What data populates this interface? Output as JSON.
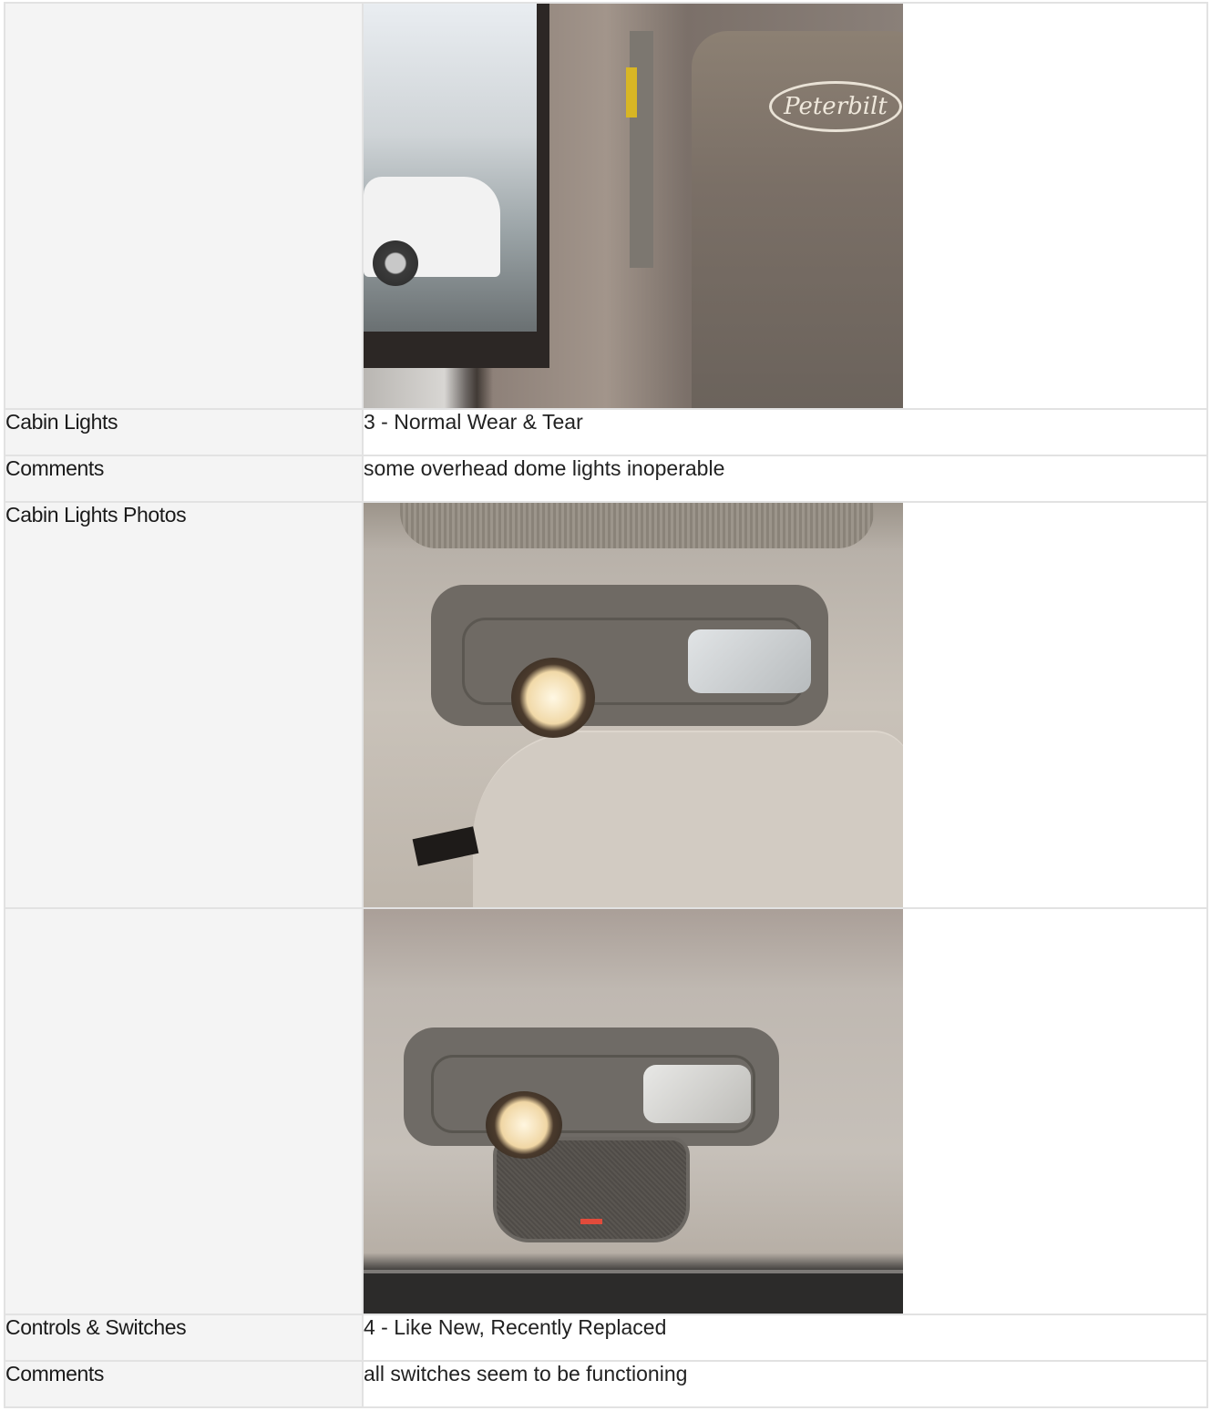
{
  "rows": [
    {
      "type": "photo",
      "label": "",
      "photo": "cab-window-seat-photo"
    },
    {
      "type": "text",
      "label": "Cabin Lights",
      "value": "3 - Normal Wear & Tear"
    },
    {
      "type": "text",
      "label": "Comments",
      "value": "some overhead dome lights inoperable"
    },
    {
      "type": "photo",
      "label": "Cabin Lights Photos",
      "photo": "dome-light-photo-1"
    },
    {
      "type": "photo",
      "label": "",
      "photo": "dome-light-photo-2"
    },
    {
      "type": "text",
      "label": "Controls & Switches",
      "value": "4 - Like New, Recently Replaced"
    },
    {
      "type": "text",
      "label": "Comments",
      "value": "all switches seem to be functioning"
    }
  ],
  "photo1": {
    "logo_text": "Peterbilt"
  }
}
